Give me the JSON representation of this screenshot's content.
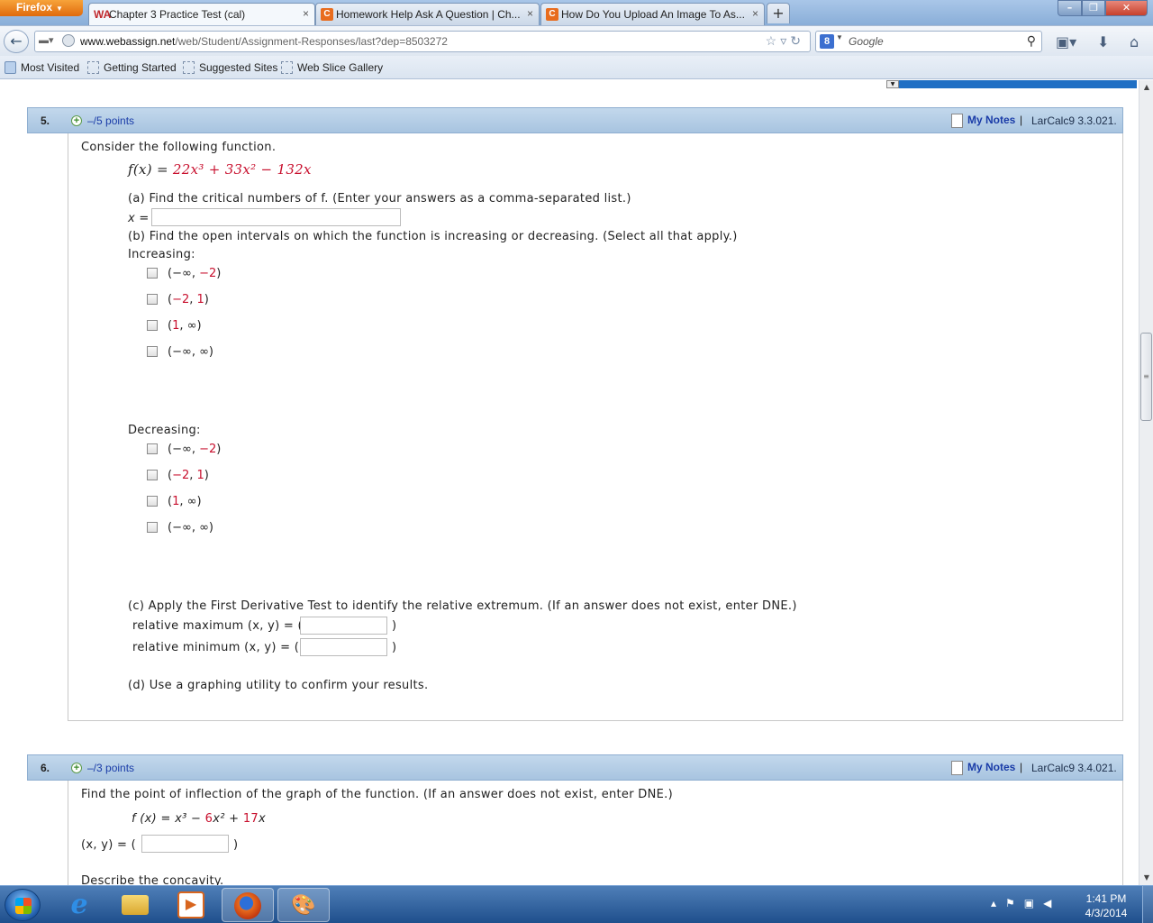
{
  "browser": {
    "menu_label": "Firefox",
    "tabs": [
      {
        "label": "Chapter 3 Practice Test (cal)",
        "favicon": "WA"
      },
      {
        "label": "Homework Help Ask A Question | Ch...",
        "favicon": "C"
      },
      {
        "label": "How Do You Upload An Image To As...",
        "favicon": "C"
      }
    ],
    "new_tab": "+",
    "close_glyph": "×",
    "url_host": "www.webassign.net",
    "url_path": "/web/Student/Assignment-Responses/last?dep=8503272",
    "search_placeholder": "Google",
    "search_engine_glyph": "8",
    "bookmarks": [
      "Most Visited",
      "Getting Started",
      "Suggested Sites",
      "Web Slice Gallery"
    ]
  },
  "q5": {
    "number": "5.",
    "points": "–/5 points",
    "notes": "My Notes",
    "separator": "|",
    "source": "LarCalc9 3.3.021.",
    "intro": "Consider the following function.",
    "func_lhs": "f(x) = ",
    "func_t1": "22x³",
    "func_op1": " + ",
    "func_t2": "33x²",
    "func_op2": " − ",
    "func_t3": "132x",
    "part_a": "(a) Find the critical numbers of f. (Enter your answers as a comma-separated list.)",
    "x_label": "x =",
    "part_b": "(b) Find the open intervals on which the function is increasing or decreasing. (Select all that apply.)",
    "increasing_label": "Increasing:",
    "decreasing_label": "Decreasing:",
    "intervals": [
      {
        "open": "(",
        "a": "−∞",
        "comma": ", ",
        "b": "−2",
        "close": ")",
        "a_red": false,
        "b_red": true
      },
      {
        "open": "(",
        "a": "−2",
        "comma": ", ",
        "b": "1",
        "close": ")",
        "a_red": true,
        "b_red": true
      },
      {
        "open": "(",
        "a": "1",
        "comma": ", ",
        "b": "∞",
        "close": ")",
        "a_red": true,
        "b_red": false
      },
      {
        "open": "(",
        "a": "−∞",
        "comma": ", ",
        "b": "∞",
        "close": ")",
        "a_red": false,
        "b_red": false
      }
    ],
    "part_c": "(c) Apply the First Derivative Test to identify the relative extremum. (If an answer does not exist, enter DNE.)",
    "rel_max": "relative maximum (x, y)  =  (",
    "rel_min": "relative minimum  (x, y)  =  (",
    "paren_close": ")",
    "part_d": "(d) Use a graphing utility to confirm your results."
  },
  "q6": {
    "number": "6.",
    "points": "–/3 points",
    "notes": "My Notes",
    "separator": "|",
    "source": "LarCalc9 3.4.021.",
    "intro": "Find the point of inflection of the graph of the function. (If an answer does not exist, enter DNE.)",
    "func_lhs": "f (x) = x³ − ",
    "func_t2": "6",
    "func_mid": "x² + ",
    "func_t3": "17",
    "func_end": "x",
    "xy_label": "(x, y) = (",
    "paren_close": ")",
    "concavity": "Describe the concavity."
  },
  "taskbar": {
    "time": "1:41 PM",
    "date": "4/3/2014"
  },
  "colors": {
    "accent_red": "#c8102e",
    "link_blue": "#1a3ca8",
    "header_blue": "#b8d0e8"
  }
}
